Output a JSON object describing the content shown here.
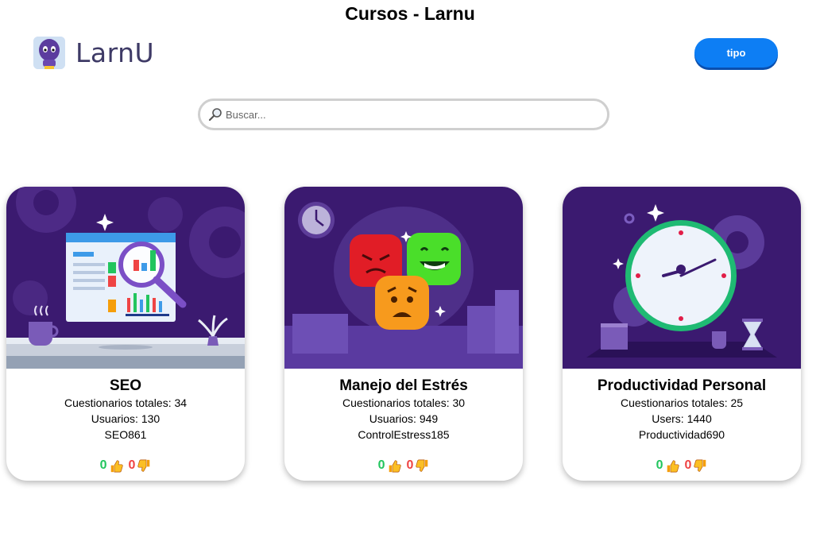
{
  "page": {
    "title": "Cursos - Larnu"
  },
  "header": {
    "logo_text": "LarnU",
    "tipo_label": "tipo"
  },
  "search": {
    "placeholder": "Buscar..."
  },
  "colors": {
    "accent": "#0d7ef4",
    "card_bg": "#3a1a6e",
    "like": "#22c55e",
    "dislike": "#ef4444"
  },
  "cards": [
    {
      "title": "SEO",
      "line1": "Cuestionarios totales: 34",
      "line2": "Usuarios: 130",
      "code": "SEO861",
      "likes": "0",
      "dislikes": "0",
      "image_icon": "seo-illustration"
    },
    {
      "title": "Manejo del Estrés",
      "line1": "Cuestionarios totales: 30",
      "line2": "Usuarios: 949",
      "code": "ControlEstress185",
      "likes": "0",
      "dislikes": "0",
      "image_icon": "stress-emoji-illustration"
    },
    {
      "title": "Productividad Personal",
      "line1": "Cuestionarios totales: 25",
      "line2": "Users: 1440",
      "code": "Productividad690",
      "likes": "0",
      "dislikes": "0",
      "image_icon": "clock-illustration"
    }
  ]
}
